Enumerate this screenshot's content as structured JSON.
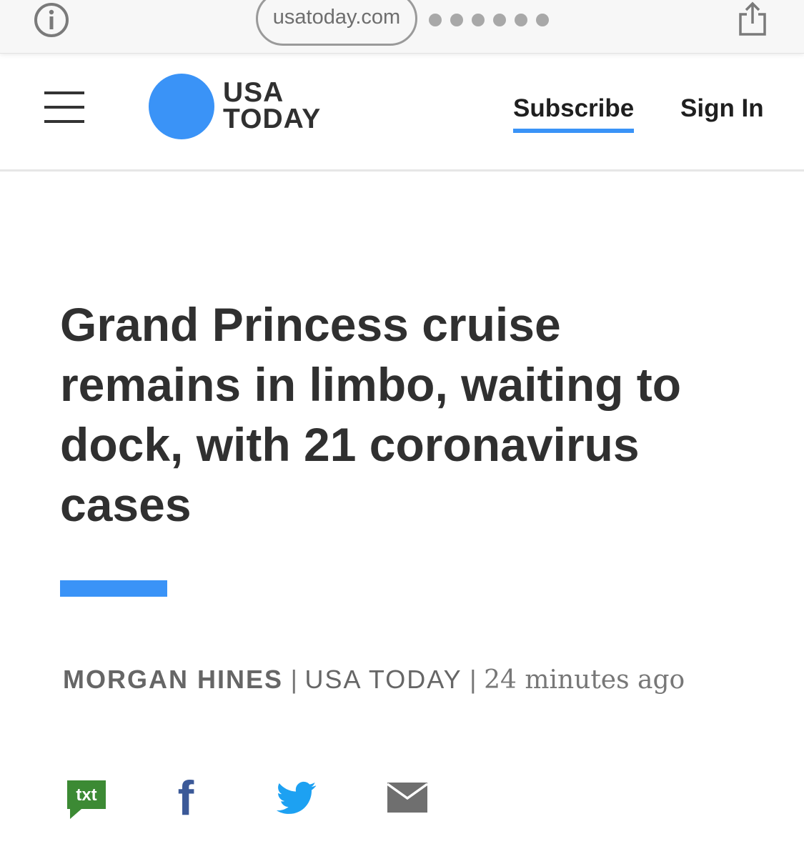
{
  "browser": {
    "url": "usatoday.com",
    "dot_count": 6
  },
  "header": {
    "logo_line1": "USA",
    "logo_line2": "TODAY",
    "subscribe_label": "Subscribe",
    "signin_label": "Sign In"
  },
  "article": {
    "headline": "Grand Princess cruise remains in limbo, waiting to dock, with 21 coronavirus cases",
    "author": "MORGAN HINES",
    "separator": "|",
    "outlet": "USA TODAY",
    "timestamp": "24 minutes ago"
  },
  "share": {
    "txt_label": "txt",
    "facebook_label": "f"
  },
  "colors": {
    "brand_blue": "#3a93f7",
    "text_dark": "#303030",
    "text_gray": "#666666",
    "txt_green": "#3c8a34",
    "facebook_blue": "#3b5998",
    "twitter_blue": "#1da1f2",
    "mail_gray": "#6f6f6f"
  }
}
